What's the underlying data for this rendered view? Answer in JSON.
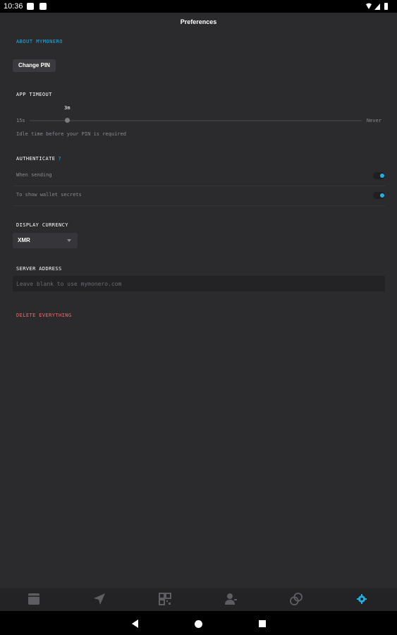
{
  "status_bar": {
    "time": "10:36"
  },
  "header": {
    "title": "Preferences"
  },
  "about_link": "ABOUT MYMONERO",
  "change_pin_label": "Change PIN",
  "app_timeout": {
    "label": "APP TIMEOUT",
    "value": "3m",
    "min_label": "15s",
    "max_label": "Never",
    "help": "Idle time before your PIN is required"
  },
  "authenticate": {
    "label": "AUTHENTICATE",
    "info": "?",
    "rows": [
      {
        "label": "When sending",
        "enabled": true
      },
      {
        "label": "To show wallet secrets",
        "enabled": true
      }
    ]
  },
  "display_currency": {
    "label": "DISPLAY CURRENCY",
    "value": "XMR"
  },
  "server_address": {
    "label": "SERVER ADDRESS",
    "placeholder": "Leave blank to use mymonero.com",
    "value": ""
  },
  "delete_label": "DELETE EVERYTHING",
  "tabs": [
    {
      "name": "wallets",
      "icon": "wallet-icon",
      "active": false
    },
    {
      "name": "send",
      "icon": "send-icon",
      "active": false
    },
    {
      "name": "request",
      "icon": "qr-code-icon",
      "active": false
    },
    {
      "name": "contacts",
      "icon": "contacts-icon",
      "active": false
    },
    {
      "name": "exchange",
      "icon": "exchange-icon",
      "active": false
    },
    {
      "name": "settings",
      "icon": "gear-icon",
      "active": true
    }
  ],
  "colors": {
    "accent": "#1fb0e4",
    "danger": "#f16a6a",
    "background": "#2b2a2d"
  }
}
